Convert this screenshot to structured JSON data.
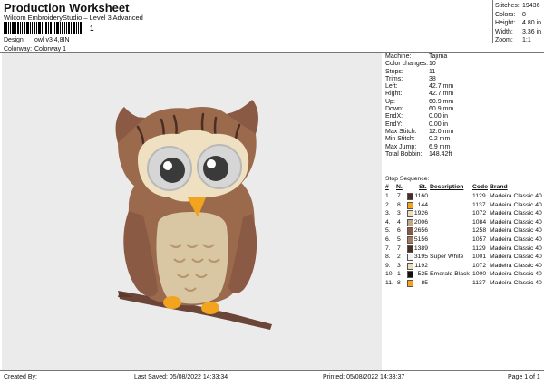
{
  "header": {
    "title": "Production Worksheet",
    "subtitle": "Wilcom EmbroideryStudio – Level 3 Advanced",
    "barcode_text": "1",
    "design_label": "Design:",
    "design_value": "owl v3 4,8IN",
    "colorway_label": "Colorway:",
    "colorway_value": "Colorway 1"
  },
  "stats": [
    {
      "label": "Stitches:",
      "value": "19436"
    },
    {
      "label": "Colors:",
      "value": "8"
    },
    {
      "label": "Height:",
      "value": "4.80 in"
    },
    {
      "label": "Width:",
      "value": "3.36 in"
    },
    {
      "label": "Zoom:",
      "value": "1:1"
    }
  ],
  "machine_info": [
    {
      "label": "Machine:",
      "value": "Tajima"
    },
    {
      "label": "Color changes:",
      "value": "10"
    },
    {
      "label": "Stops:",
      "value": "11"
    },
    {
      "label": "Trims:",
      "value": "38"
    },
    {
      "label": "Left:",
      "value": "42.7 mm"
    },
    {
      "label": "Right:",
      "value": "42.7 mm"
    },
    {
      "label": "Up:",
      "value": "60.9 mm"
    },
    {
      "label": "Down:",
      "value": "60.9 mm"
    },
    {
      "label": "EndX:",
      "value": "0.00 in"
    },
    {
      "label": "EndY:",
      "value": "0.00 in"
    },
    {
      "label": "Max Stitch:",
      "value": "12.0 mm"
    },
    {
      "label": "Min Stitch:",
      "value": "0.2 mm"
    },
    {
      "label": "Max Jump:",
      "value": "6.9 mm"
    },
    {
      "label": "Total Bobbin:",
      "value": "148.42ft"
    }
  ],
  "stop_sequence": {
    "title": "Stop Sequence:",
    "headers": [
      "#",
      "N.",
      "St.",
      "Description",
      "Code",
      "Brand"
    ],
    "rows": [
      {
        "num": "1.",
        "n": "7",
        "color": "#4b2e22",
        "st": "1160",
        "desc": "",
        "code": "1129",
        "brand": "Madeira Classic 40"
      },
      {
        "num": "2.",
        "n": "8",
        "color": "#f5a21c",
        "st": "144",
        "desc": "",
        "code": "1137",
        "brand": "Madeira Classic 40"
      },
      {
        "num": "3.",
        "n": "3",
        "color": "#ecdcb7",
        "st": "1926",
        "desc": "",
        "code": "1072",
        "brand": "Madeira Classic 40"
      },
      {
        "num": "4.",
        "n": "4",
        "color": "#c2a886",
        "st": "2006",
        "desc": "",
        "code": "1084",
        "brand": "Madeira Classic 40"
      },
      {
        "num": "5.",
        "n": "6",
        "color": "#8a5a44",
        "st": "2656",
        "desc": "",
        "code": "1258",
        "brand": "Madeira Classic 40"
      },
      {
        "num": "6.",
        "n": "5",
        "color": "#a87858",
        "st": "5156",
        "desc": "",
        "code": "1057",
        "brand": "Madeira Classic 40"
      },
      {
        "num": "7.",
        "n": "7",
        "color": "#4b2e22",
        "st": "1389",
        "desc": "",
        "code": "1129",
        "brand": "Madeira Classic 40"
      },
      {
        "num": "8.",
        "n": "2",
        "color": "#f2f2f4",
        "st": "3195",
        "desc": "Super White",
        "code": "1001",
        "brand": "Madeira Classic 40"
      },
      {
        "num": "9.",
        "n": "3",
        "color": "#ecdcb7",
        "st": "1192",
        "desc": "",
        "code": "1072",
        "brand": "Madeira Classic 40"
      },
      {
        "num": "10.",
        "n": "1",
        "color": "#111111",
        "st": "525",
        "desc": "Emerald Black",
        "code": "1000",
        "brand": "Madeira Classic 40"
      },
      {
        "num": "11.",
        "n": "8",
        "color": "#f5a21c",
        "st": "85",
        "desc": "",
        "code": "1137",
        "brand": "Madeira Classic 40"
      }
    ]
  },
  "footer": {
    "created_by": "Created By:",
    "last_saved": "Last Saved: 05/08/2022 14:33:34",
    "printed": "Printed: 05/08/2022 14:33:37",
    "page": "Page 1 of 1"
  },
  "colors": {
    "design_bg": "#ebebeb",
    "owl_body": "#9b6a4d",
    "owl_belly": "#d9c6a2",
    "owl_face": "#eee0c0",
    "beak": "#f2a41f",
    "branch": "#6b4638"
  }
}
